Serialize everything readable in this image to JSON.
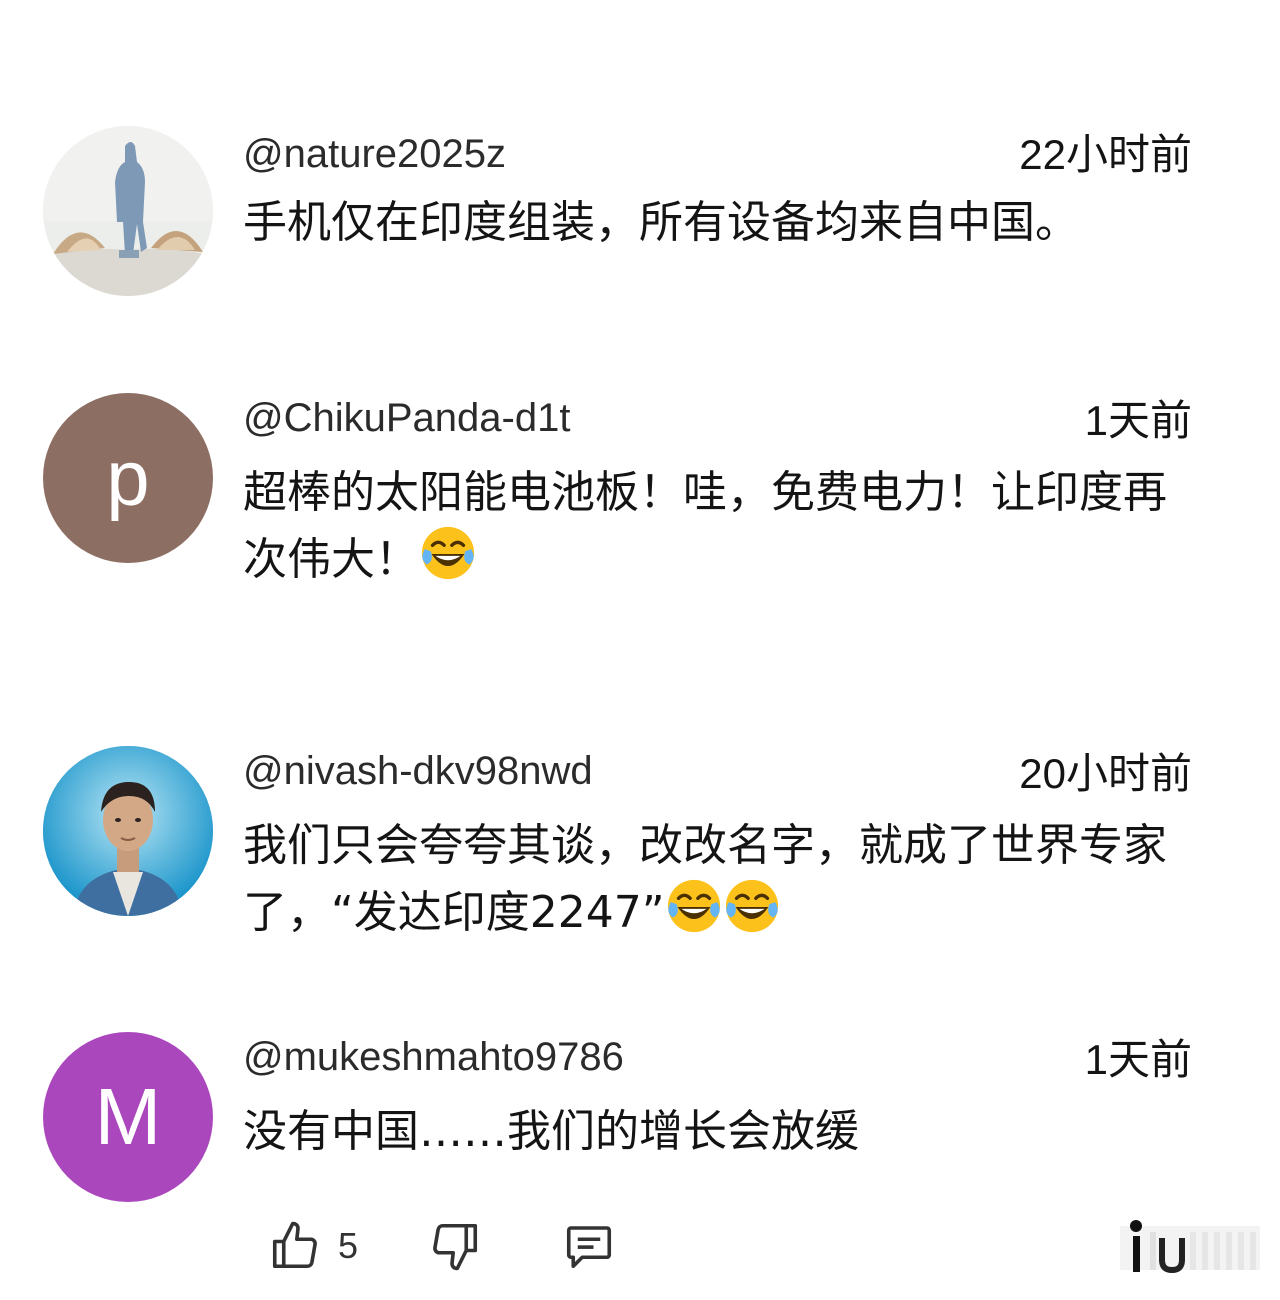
{
  "comments": [
    {
      "handle": "@nature2025z",
      "time": "22小时前",
      "text": "手机仅在印度组装，所有设备均来自中国。",
      "emoji_count": 0,
      "avatar": {
        "kind": "photo",
        "subject": "statue-landscape"
      }
    },
    {
      "handle": "@ChikuPanda-d1t",
      "time": "1天前",
      "text": "超棒的太阳能电池板！哇，免费电力！让印度再次伟大！",
      "emoji_count": 1,
      "avatar": {
        "kind": "letter",
        "letter": "p",
        "color": "#8d6e63"
      }
    },
    {
      "handle": "@nivash-dkv98nwd",
      "time": "20小时前",
      "text": "我们只会夸夸其谈，改改名字，就成了世界专家了，“发达印度2247”",
      "emoji_count": 2,
      "avatar": {
        "kind": "photo",
        "subject": "person-portrait"
      }
    },
    {
      "handle": "@mukeshmahto9786",
      "time": "1天前",
      "text": "没有中国……我们的增长会放缓",
      "emoji_count": 0,
      "avatar": {
        "kind": "letter",
        "letter": "M",
        "color": "#ab47bc"
      }
    }
  ],
  "actions": {
    "like_count": "5",
    "icons": [
      "thumbs-up-icon",
      "thumbs-down-icon",
      "reply-icon"
    ]
  },
  "emoji_name": "face-with-tears-of-joy",
  "colors": {
    "text": "#141414",
    "avatar_p": "#8d6e63",
    "avatar_m": "#ab47bc"
  }
}
